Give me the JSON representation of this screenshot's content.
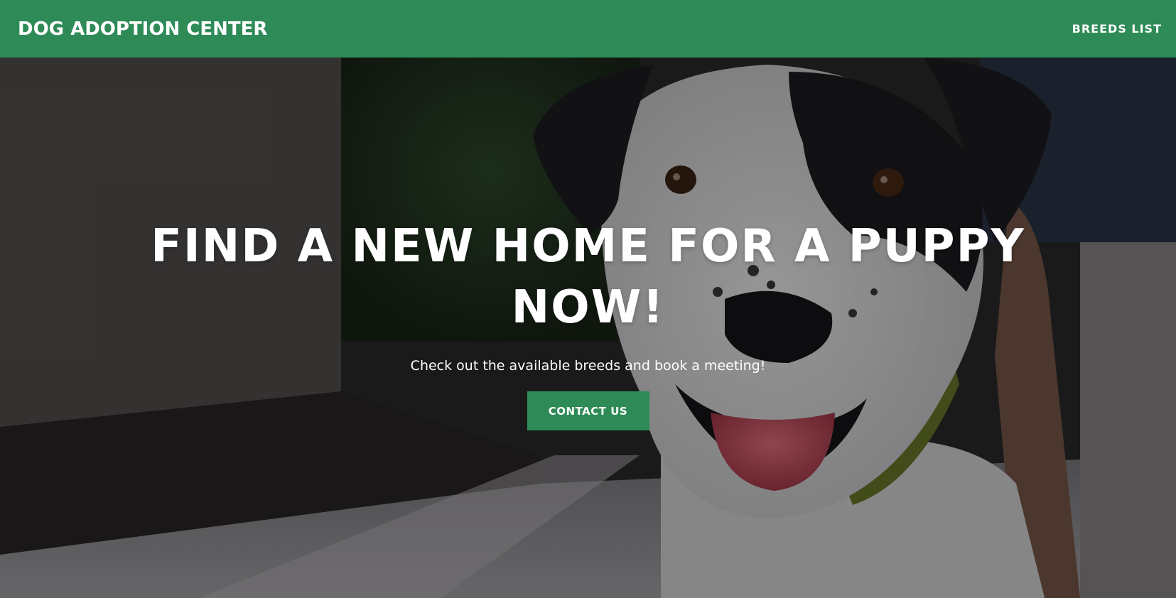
{
  "navbar": {
    "brand": "DOG ADOPTION CENTER",
    "links": [
      {
        "label": "BREEDS LIST"
      }
    ],
    "background_color": "#2e8b57"
  },
  "hero": {
    "background_image": "photo of a black-and-white dog smiling on a sidewalk",
    "title": "FIND A NEW HOME FOR A PUPPY NOW!",
    "subtitle": "Check out the available breeds and book a meeting!",
    "cta_label": "CONTACT US",
    "cta_color": "#2e8b57"
  }
}
